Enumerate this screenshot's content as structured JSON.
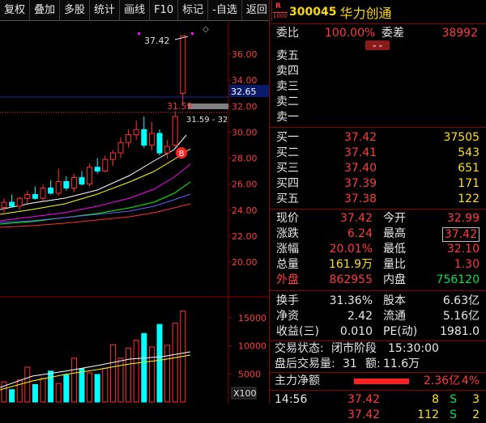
{
  "toolbar": [
    "复权",
    "叠加",
    "多股",
    "统计",
    "画线",
    "F10",
    "标记",
    "-自选",
    "返回"
  ],
  "stock": {
    "badge_top": "R",
    "badge_bottom": "1000",
    "code": "300045",
    "name": "华力创通"
  },
  "weibi": {
    "label": "委比",
    "value": "100.00%",
    "label2": "委差",
    "value2": "38992"
  },
  "sells": [
    {
      "label": "卖五"
    },
    {
      "label": "卖四"
    },
    {
      "label": "卖三"
    },
    {
      "label": "卖二"
    },
    {
      "label": "卖一"
    }
  ],
  "buys": [
    {
      "label": "买一",
      "price": "37.42",
      "vol": "37505"
    },
    {
      "label": "买二",
      "price": "37.41",
      "vol": "543"
    },
    {
      "label": "买三",
      "price": "37.40",
      "vol": "651"
    },
    {
      "label": "买四",
      "price": "37.39",
      "vol": "171"
    },
    {
      "label": "买五",
      "price": "37.38",
      "vol": "122"
    }
  ],
  "quote": [
    {
      "l1": "现价",
      "v1": "37.42",
      "l2": "今开",
      "v2": "32.99"
    },
    {
      "l1": "涨跌",
      "v1": "6.24",
      "l2": "最高",
      "v2": "37.42"
    },
    {
      "l1": "涨幅",
      "v1": "20.01%",
      "l2": "最低",
      "v2": "32.10"
    },
    {
      "l1": "总量",
      "v1": "161.9万",
      "l2": "量比",
      "v2": "1.30"
    },
    {
      "l1": "外盘",
      "v1": "862955",
      "l2": "内盘",
      "v2": "756120"
    }
  ],
  "stats": [
    {
      "l1": "换手",
      "v1": "31.36%",
      "l2": "股本",
      "v2": "6.63亿"
    },
    {
      "l1": "净资",
      "v1": "2.42",
      "l2": "流通",
      "v2": "5.16亿"
    },
    {
      "l1": "收益(三)",
      "v1": "0.010",
      "l2": "PE(动)",
      "v2": "1981.0"
    }
  ],
  "trade_status": {
    "label": "交易状态:",
    "value": "闭市阶段",
    "time": "15:30:00"
  },
  "after_hours": {
    "label": "盘后交易量:",
    "vol": "31",
    "amt_label": "额:",
    "amt": "11.6万"
  },
  "main_force": {
    "label": "主力净额",
    "value": "2.36亿",
    "pct": "4%"
  },
  "ticks": [
    {
      "time": "14:56",
      "price": "37.42",
      "vol": "8",
      "side": "S",
      "n": "3"
    },
    {
      "time": "",
      "price": "37.42",
      "vol": "112",
      "side": "S",
      "n": "2"
    }
  ],
  "chart_data": {
    "type": "candlestick",
    "price_axis": [
      "36.00",
      "34.00",
      "32.00",
      "30.00",
      "28.00",
      "26.00",
      "24.00",
      "22.00",
      "20.00"
    ],
    "current_price_tag": "32.65",
    "annot_high": "37.42",
    "annot_prev": "31.59",
    "annot_prev2": "31.59 - 32",
    "marker_b": "B",
    "volume_axis": [
      "15000",
      "10000",
      "5000"
    ],
    "volume_unit": "X100",
    "colors": {
      "up": "#ff3030",
      "down": "#00ffff",
      "ma5": "#ffffff",
      "ma10": "#ffff00",
      "ma20": "#ff00ff",
      "ma30": "#00ff00",
      "ma60": "#0000ff"
    },
    "candles": [
      {
        "o": 24.2,
        "h": 24.9,
        "l": 23.8,
        "c": 24.6
      },
      {
        "o": 24.6,
        "h": 25.2,
        "l": 24.2,
        "c": 24.3
      },
      {
        "o": 24.3,
        "h": 25.0,
        "l": 24.0,
        "c": 24.9
      },
      {
        "o": 24.9,
        "h": 25.5,
        "l": 24.5,
        "c": 25.2
      },
      {
        "o": 25.2,
        "h": 25.8,
        "l": 24.8,
        "c": 24.9
      },
      {
        "o": 24.9,
        "h": 26.0,
        "l": 24.7,
        "c": 25.7
      },
      {
        "o": 25.7,
        "h": 26.3,
        "l": 25.2,
        "c": 25.3
      },
      {
        "o": 25.3,
        "h": 27.2,
        "l": 25.1,
        "c": 26.2
      },
      {
        "o": 26.2,
        "h": 26.6,
        "l": 25.5,
        "c": 25.7
      },
      {
        "o": 25.7,
        "h": 26.8,
        "l": 25.4,
        "c": 26.5
      },
      {
        "o": 26.5,
        "h": 27.0,
        "l": 25.9,
        "c": 26.0
      },
      {
        "o": 26.0,
        "h": 27.6,
        "l": 25.8,
        "c": 27.3
      },
      {
        "o": 27.3,
        "h": 28.0,
        "l": 26.8,
        "c": 27.0
      },
      {
        "o": 27.0,
        "h": 28.2,
        "l": 26.9,
        "c": 27.9
      },
      {
        "o": 27.9,
        "h": 28.6,
        "l": 27.4,
        "c": 28.4
      },
      {
        "o": 28.4,
        "h": 29.6,
        "l": 28.0,
        "c": 29.2
      },
      {
        "o": 29.2,
        "h": 30.2,
        "l": 28.8,
        "c": 29.8
      },
      {
        "o": 29.8,
        "h": 30.9,
        "l": 29.4,
        "c": 30.2
      },
      {
        "o": 30.2,
        "h": 31.2,
        "l": 28.8,
        "c": 29.0
      },
      {
        "o": 29.0,
        "h": 30.8,
        "l": 28.6,
        "c": 29.9
      },
      {
        "o": 29.9,
        "h": 30.2,
        "l": 28.2,
        "c": 28.4
      },
      {
        "o": 28.4,
        "h": 29.4,
        "l": 28.0,
        "c": 28.9
      },
      {
        "o": 29.0,
        "h": 31.6,
        "l": 28.8,
        "c": 31.2
      },
      {
        "o": 32.99,
        "h": 37.42,
        "l": 32.1,
        "c": 37.42
      }
    ],
    "volumes": [
      3600,
      2200,
      3900,
      6200,
      3100,
      4200,
      5500,
      3300,
      4800,
      7800,
      5900,
      5200,
      4900,
      6000,
      10200,
      7800,
      9600,
      11000,
      12200,
      9800,
      13800,
      10100,
      14000,
      16200
    ]
  }
}
